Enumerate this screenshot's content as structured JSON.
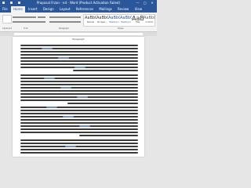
{
  "window": {
    "title": "Proposal Frzan - nd - Word (Product Activation Failed)",
    "controls": [
      "—",
      "□",
      "✕"
    ]
  },
  "tabs": [
    "File",
    "Home",
    "Insert",
    "Design",
    "Layout",
    "References",
    "Mailings",
    "Review",
    "View"
  ],
  "active_tab": "Home",
  "styles": [
    {
      "sample": "AaBbCcI",
      "name": "Normal"
    },
    {
      "sample": "AaBbCcI",
      "name": "No Spac..."
    },
    {
      "sample": "AaBbC",
      "name": "Heading 1"
    },
    {
      "sample": "AaBbCc",
      "name": "Heading 2"
    },
    {
      "sample": "AaB",
      "name": "Title"
    },
    {
      "sample": "AaBbCcI",
      "name": "Subtitle"
    }
  ],
  "group_labels": [
    "Clipboard",
    "Font",
    "Paragraph",
    "Styles"
  ],
  "paragraph_label": "Paragraph"
}
